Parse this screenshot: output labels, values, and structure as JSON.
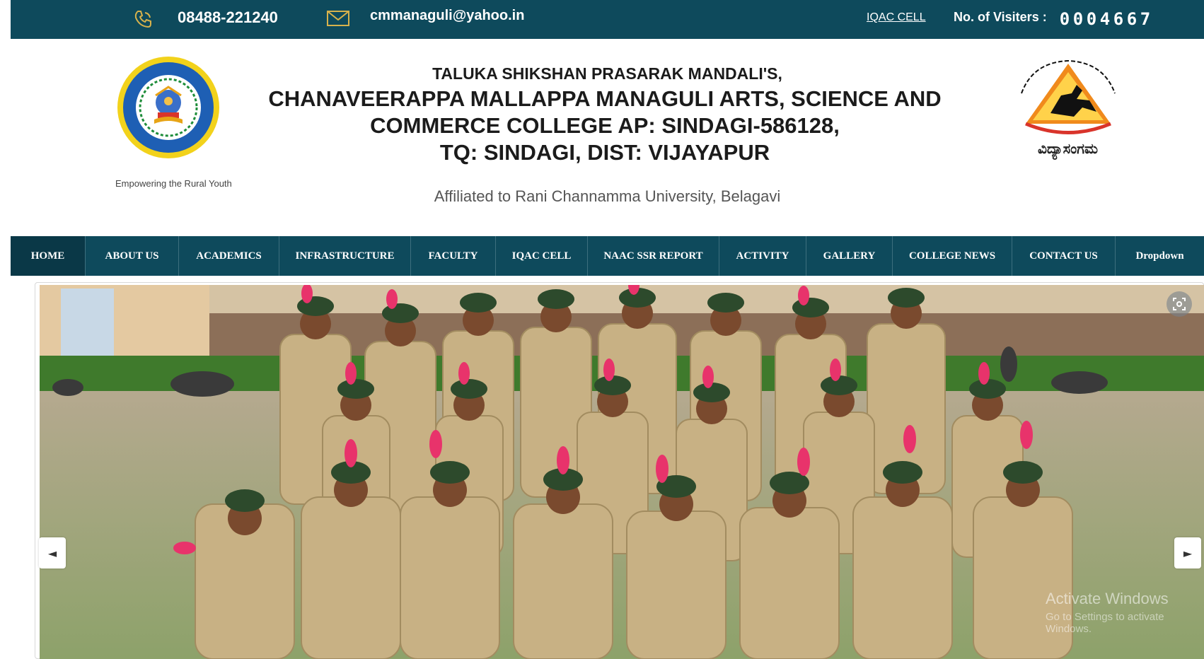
{
  "topbar": {
    "phone": "08488-221240",
    "email": "cmmanaguli@yahoo.in",
    "iqac_link": "IQAC CELL",
    "visitors_label": "No. of  Visiters :",
    "visitor_digits": [
      "0",
      "0",
      "0",
      "4",
      "6",
      "6",
      "7"
    ]
  },
  "header": {
    "tagline": "Empowering the Rural Youth",
    "org": "TALUKA SHIKSHAN PRASARAK MANDALI'S,",
    "college_line1": "CHANAVEERAPPA MALLAPPA MANAGULI ARTS, SCIENCE AND",
    "college_line2": "COMMERCE COLLEGE AP: SINDAGI-586128,",
    "college_line3": "TQ: SINDAGI, DIST: VIJAYAPUR",
    "affiliation": "Affiliated to Rani Channamma University, Belagavi",
    "right_logo_text": "ವಿದ್ಯಾಸಂಗಮ"
  },
  "nav": {
    "items": [
      "HOME",
      "ABOUT US",
      "ACADEMICS",
      "INFRASTRUCTURE",
      "FACULTY",
      "IQAC CELL",
      "NAAC SSR REPORT",
      "ACTIVITY",
      "GALLERY",
      "COLLEGE NEWS",
      "CONTACT US",
      "Dropdown"
    ]
  },
  "slider": {
    "prev": "◄",
    "next": "►",
    "watermark": "Activate Windows",
    "watermark_sub": "Go to Settings to activate Windows."
  },
  "colors": {
    "primary": "#0e4a5c",
    "active": "#0a3847"
  }
}
